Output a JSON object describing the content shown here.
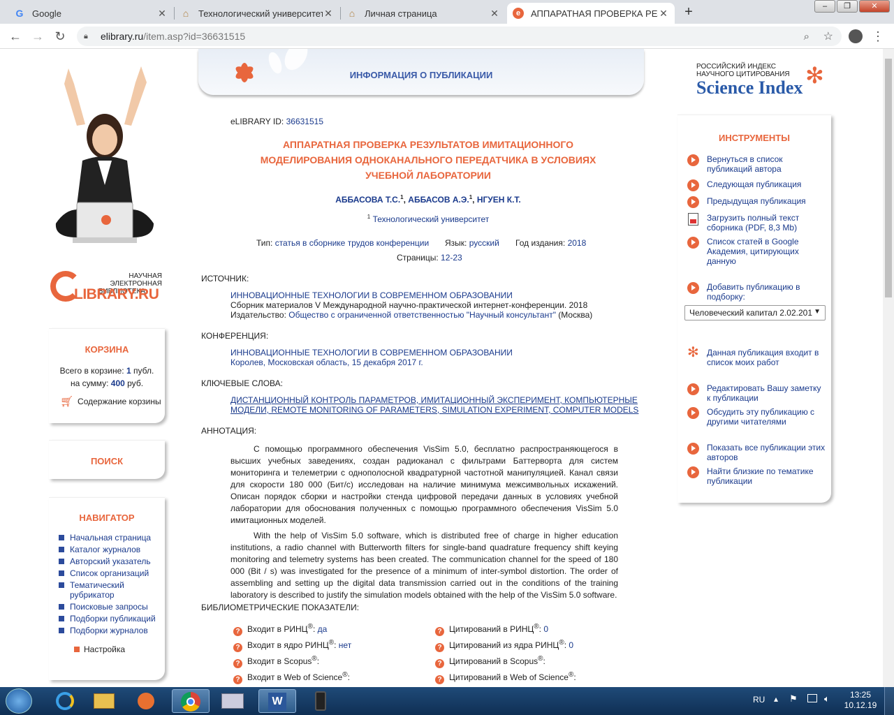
{
  "browser": {
    "tabs": [
      {
        "title": "Google",
        "icon": "google-icon"
      },
      {
        "title": "Технологический университет",
        "icon": "university-icon"
      },
      {
        "title": "Личная страница",
        "icon": "university-icon"
      },
      {
        "title": "АППАРАТНАЯ ПРОВЕРКА РЕЗУЛ",
        "icon": "elibrary-icon"
      }
    ],
    "url_host": "elibrary.ru",
    "url_path": "/item.asp?id=36631515"
  },
  "left": {
    "logo_line1": "НАУЧНАЯ ЭЛЕКТРОННАЯ",
    "logo_line2": "БИБЛИОТЕКА",
    "logo_brand": "LIBRARY.RU",
    "logo_e": "e",
    "cart": {
      "title": "КОРЗИНА",
      "line1_prefix": "Всего в корзине:",
      "count": "1",
      "line1_suffix": "публ.",
      "line2_prefix": "на сумму:",
      "sum": "400",
      "line2_suffix": "руб.",
      "contents_label": "Содержание корзины"
    },
    "search_title": "ПОИСК",
    "navigator": {
      "title": "НАВИГАТОР",
      "items": [
        "Начальная страница",
        "Каталог журналов",
        "Авторский указатель",
        "Список организаций",
        "Тематический рубрикатор",
        "Поисковые запросы",
        "Подборки публикаций",
        "Подборки журналов"
      ],
      "settings": "Настройка"
    }
  },
  "center": {
    "header": "ИНФОРМАЦИЯ О ПУБЛИКАЦИИ",
    "elib_id_label": "eLIBRARY ID:",
    "elib_id": "36631515",
    "title_line1": "АППАРАТНАЯ ПРОВЕРКА РЕЗУЛЬТАТОВ ИМИТАЦИОННОГО",
    "title_line2": "МОДЕЛИРОВАНИЯ ОДНОКАНАЛЬНОГО ПЕРЕДАТЧИКА В УСЛОВИЯХ",
    "title_line3": "УЧЕБНОЙ ЛАБОРАТОРИИ",
    "authors": [
      "АББАСОВА Т.С.",
      "АББАСОВ А.Э.",
      "НГУЕН К.Т."
    ],
    "author_sup": "1",
    "affiliation": "Технологический университет",
    "type_label": "Тип:",
    "type_value": "статья в сборнике трудов конференции",
    "lang_label": "Язык:",
    "lang_value": "русский",
    "year_label": "Год издания:",
    "year_value": "2018",
    "pages_label": "Страницы:",
    "pages_value": "12-23",
    "source_label": "ИСТОЧНИК:",
    "source_title": "ИННОВАЦИОННЫЕ ТЕХНОЛОГИИ В СОВРЕМЕННОМ ОБРАЗОВАНИИ",
    "source_desc": "Сборник материалов V Международной научно-практической интернет-конференции. 2018",
    "publisher_label": "Издательство:",
    "publisher": "Общество с ограниченной ответственностью \"Научный консультант\"",
    "publisher_city": "(Москва)",
    "conf_label": "КОНФЕРЕНЦИЯ:",
    "conf_title": "ИННОВАЦИОННЫЕ ТЕХНОЛОГИИ В СОВРЕМЕННОМ ОБРАЗОВАНИИ",
    "conf_place": "Королев, Московская область, 15 декабря 2017 г.",
    "kw_label": "КЛЮЧЕВЫЕ СЛОВА:",
    "kw_line1": "ДИСТАНЦИОННЫЙ КОНТРОЛЬ ПАРАМЕТРОВ, ИМИТАЦИОННЫЙ ЭКСПЕРИМЕНТ, КОМПЬЮТЕРНЫЕ",
    "kw_line2": "МОДЕЛИ, REMOTE MONITORING OF PARAMETERS, SIMULATION EXPERIMENT, COMPUTER MODELS",
    "anno_label": "АННОТАЦИЯ:",
    "anno_ru": "С помощью программного обеспечения VisSim 5.0, бесплатно распространяющегося в высших учебных заведениях, создан радиоканал с фильтрами Баттерворта для систем мониторинга и телеметрии с однополосной квадратурной частотной манипуляцией. Канал связи для скорости 180 000 (Бит/с) исследован на наличие минимума межсимвольных искажений. Описан порядок сборки и настройки стенда цифровой передачи данных в условиях учебной лаборатории для обоснования полученных с помощью программного обеспечения VisSim 5.0 имитационных моделей.",
    "anno_en": "With the help of VisSim 5.0 software, which is distributed free of charge in higher education institutions, a radio channel with Butterworth filters for single-band quadrature frequency shift keying monitoring and telemetry systems has been created. The communication channel for the speed of 180 000 (Bit / s) was investigated for the presence of a minimum of inter-symbol distortion. The order of assembling and setting up the digital data transmission carried out in the conditions of the training laboratory is described to justify the simulation models obtained with the help of the VisSim 5.0 software.",
    "biblio_label": "БИБЛИОМЕТРИЧЕСКИЕ ПОКАЗАТЕЛИ:",
    "biblio_left": [
      {
        "label": "Входит в РИНЦ",
        "sup": "®",
        "value": "да"
      },
      {
        "label": "Входит в ядро РИНЦ",
        "sup": "®",
        "value": "нет"
      },
      {
        "label": "Входит в Scopus",
        "sup": "®",
        "value": ""
      },
      {
        "label": "Входит в Web of Science",
        "sup": "®",
        "value": ""
      }
    ],
    "biblio_right": [
      {
        "label": "Цитирований в РИНЦ",
        "sup": "®",
        "value": "0"
      },
      {
        "label": "Цитирований из ядра РИНЦ",
        "sup": "®",
        "value": "0"
      },
      {
        "label": "Цитирований в Scopus",
        "sup": "®",
        "value": ""
      },
      {
        "label": "Цитирований в Web of Science",
        "sup": "®",
        "value": ""
      }
    ]
  },
  "right": {
    "si_line1": "РОССИЙСКИЙ ИНДЕКС",
    "si_line2": "НАУЧНОГО ЦИТИРОВАНИЯ",
    "si_brand": "Science Index",
    "tools_title": "ИНСТРУМЕНТЫ",
    "tools": [
      "Вернуться в список публикаций автора",
      "Следующая публикация",
      "Предыдущая публикация",
      "Загрузить полный текст сборника (PDF, 8,3 Mb)",
      "Список статей в Google Академия, цитирующих данную",
      "Добавить публикацию в подборку:"
    ],
    "collection_select": "Человеческий капитал 2.02.201",
    "tools2": [
      "Данная публикация входит в список моих работ",
      "Редактировать Вашу заметку к публикации",
      "Обсудить эту публикацию с другими читателями",
      "Показать все публикации этих авторов",
      "Найти близкие по тематике публикации"
    ]
  },
  "taskbar": {
    "lang": "RU",
    "time": "13:25",
    "date": "10.12.19"
  }
}
